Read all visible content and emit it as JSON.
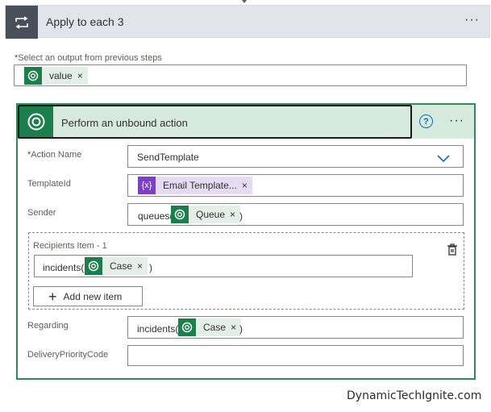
{
  "apply_each": {
    "title": "Apply to each 3",
    "more": "···"
  },
  "select_output": {
    "label": "Select an output from previous steps",
    "required_mark": "*",
    "token": {
      "label": "value",
      "remove": "×",
      "icon": "dataverse-icon"
    }
  },
  "action": {
    "title": "Perform an unbound action",
    "help": "?",
    "more": "···",
    "fields": {
      "action_name": {
        "label": "Action Name",
        "required_mark": "*",
        "value": "SendTemplate"
      },
      "template_id": {
        "label": "TemplateId",
        "token": {
          "label": "Email Template...",
          "remove": "×",
          "icon": "expression-icon",
          "icon_text": "{x}"
        }
      },
      "sender": {
        "label": "Sender",
        "prefix": "queues(",
        "token": {
          "label": "Queue",
          "remove": "×"
        },
        "suffix": ")"
      },
      "recipients": {
        "label": "Recipients Item - 1",
        "prefix": "incidents(",
        "token": {
          "label": "Case",
          "remove": "×"
        },
        "suffix": ")",
        "add_button": "Add new item"
      },
      "regarding": {
        "label": "Regarding",
        "prefix": "incidents(",
        "token": {
          "label": "Case",
          "remove": "×"
        },
        "suffix": ")"
      },
      "delivery_priority": {
        "label": "DeliveryPriorityCode",
        "value": ""
      }
    }
  },
  "watermark": "DynamicTechIgnite.com",
  "colors": {
    "dataverse_green": "#1a7f4b",
    "header_green": "#d7eade",
    "expression_purple": "#7b3fc9",
    "accent_blue": "#0f6cbd"
  }
}
